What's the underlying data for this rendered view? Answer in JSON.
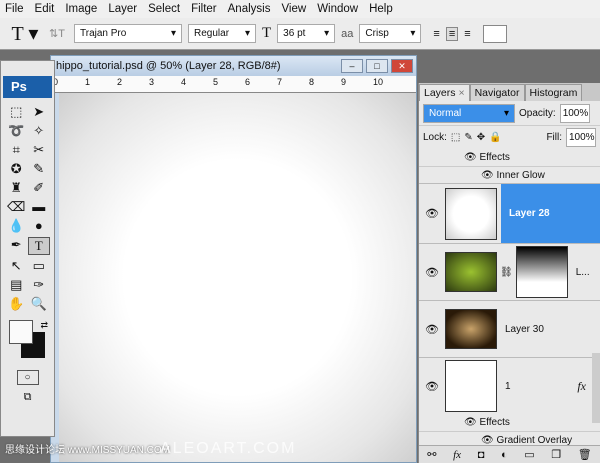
{
  "menu": [
    "File",
    "Edit",
    "Image",
    "Layer",
    "Select",
    "Filter",
    "Analysis",
    "View",
    "Window",
    "Help"
  ],
  "options": {
    "font_family": "Trajan Pro",
    "font_style": "Regular",
    "font_size": "36 pt",
    "antialias": "Crisp"
  },
  "document": {
    "title": "hippo_tutorial.psd @ 50% (Layer 28, RGB/8#)",
    "ruler_ticks": [
      "0",
      "1",
      "2",
      "3",
      "4",
      "5",
      "6",
      "7",
      "8",
      "9",
      "10"
    ]
  },
  "toolbox": {
    "logo": "Ps"
  },
  "layers_panel": {
    "tabs": [
      "Layers",
      "Navigator",
      "Histogram"
    ],
    "blend_mode": "Normal",
    "opacity_label": "Opacity:",
    "opacity": "100%",
    "lock_label": "Lock:",
    "fill_label": "Fill:",
    "fill": "100%",
    "top_effects": [
      "Effects",
      "Inner Glow"
    ],
    "layers": [
      {
        "name": "Layer 28",
        "selected": true
      },
      {
        "name": "L...",
        "mask": true
      },
      {
        "name": "Layer 30"
      },
      {
        "name": "1",
        "fx": "fx"
      }
    ],
    "bottom_effects": [
      "Effects",
      "Gradient Overlay"
    ]
  },
  "watermark": {
    "site": "思缘设计论坛 www.MISSYUAN.COM",
    "brand": "ALEOART.COM"
  },
  "colors": {
    "accent": "#3b8fe8",
    "ps_blue": "#1b5fa9"
  }
}
